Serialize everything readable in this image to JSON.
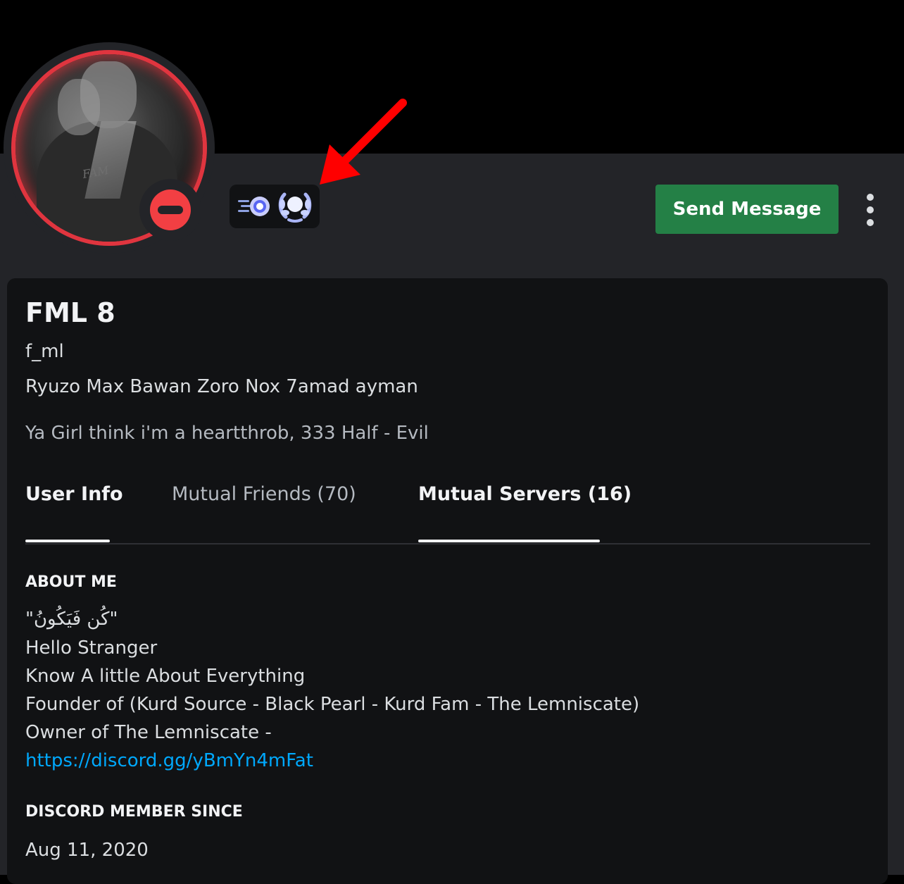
{
  "profile": {
    "display_name": "FML 8",
    "username": "f_ml",
    "pronouns": "Ryuzo Max Bawan Zoro Nox 7amad ayman",
    "custom_status": "Ya Girl think i'm a heartthrob, 333 Half - Evil",
    "status": "do-not-disturb",
    "avatar_ring_color": "#e0353f",
    "avatar_overlay_text": "FAM",
    "badges": [
      "hypesquad-speed-badge-icon",
      "laurel-badge-icon"
    ]
  },
  "actions": {
    "send_message_label": "Send Message",
    "more_icon": "vertical-ellipsis-icon"
  },
  "tabs": [
    {
      "label": "User Info",
      "active": true
    },
    {
      "label": "Mutual Friends (70)",
      "active": false
    },
    {
      "label": "Mutual Servers (16)",
      "active": true
    }
  ],
  "about": {
    "heading": "ABOUT ME",
    "lines": [
      "\"كُن فَيَكُونُ\"",
      "Hello Stranger",
      "Know A little About Everything",
      "Founder of (Kurd Source - Black Pearl - Kurd Fam - The Lemniscate)",
      "Owner of The Lemniscate -"
    ],
    "link": "https://discord.gg/yBmYn4mFat"
  },
  "member_since": {
    "heading": "DISCORD MEMBER SINCE",
    "date": "Aug 11, 2020"
  },
  "colors": {
    "background": "#000000",
    "profile_body": "#232428",
    "card": "#111214",
    "send_button": "#248046",
    "link": "#00a8fc",
    "dnd": "#f23f43",
    "annotation_arrow": "#ff0000"
  }
}
